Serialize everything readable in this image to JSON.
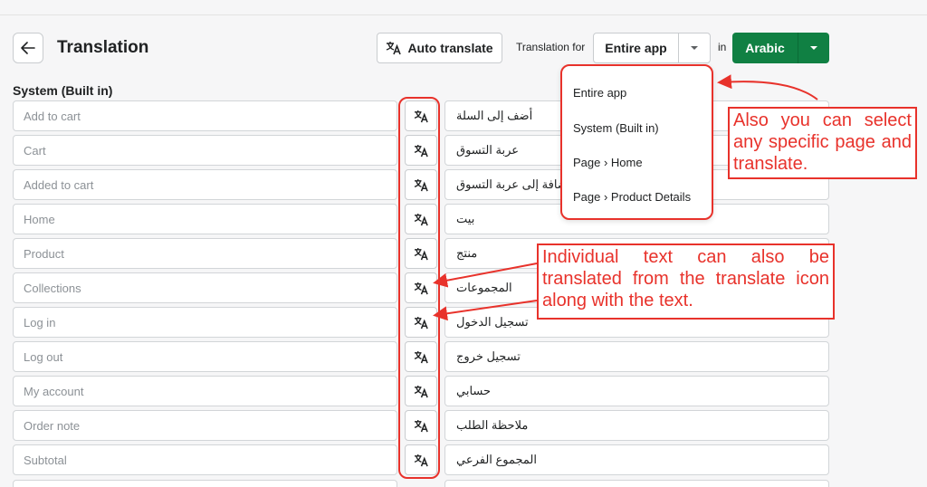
{
  "header": {
    "title": "Translation",
    "auto_translate_label": "Auto translate",
    "translation_for_label": "Translation for",
    "scope_value": "Entire app",
    "in_label": "in",
    "language_value": "Arabic"
  },
  "section": {
    "title": "System (Built in)"
  },
  "rows": [
    {
      "source": "Add to cart",
      "translation": "أضف إلى السلة"
    },
    {
      "source": "Cart",
      "translation": "عربة التسوق"
    },
    {
      "source": "Added to cart",
      "translation": "أضافة إلى عربة التسوق"
    },
    {
      "source": "Home",
      "translation": "بيت"
    },
    {
      "source": "Product",
      "translation": "منتج"
    },
    {
      "source": "Collections",
      "translation": "المجموعات"
    },
    {
      "source": "Log in",
      "translation": "تسجيل الدخول"
    },
    {
      "source": "Log out",
      "translation": "تسجيل خروج"
    },
    {
      "source": "My account",
      "translation": "حسابي"
    },
    {
      "source": "Order note",
      "translation": "ملاحظة الطلب"
    },
    {
      "source": "Subtotal",
      "translation": "المجموع الفرعي"
    }
  ],
  "dropdown": {
    "options": [
      "Entire app",
      "System (Built in)",
      "Page › Home",
      "Page › Product Details"
    ]
  },
  "annotations": {
    "note_scope": "Also you can select any specific page and translate.",
    "note_icon": "Individual text can also be translated from the translate icon along with the text."
  },
  "colors": {
    "primary_green": "#108043",
    "annotation_red": "#e8322b"
  },
  "icons": [
    "back-arrow-icon",
    "translate-icon",
    "chevron-down-icon"
  ]
}
